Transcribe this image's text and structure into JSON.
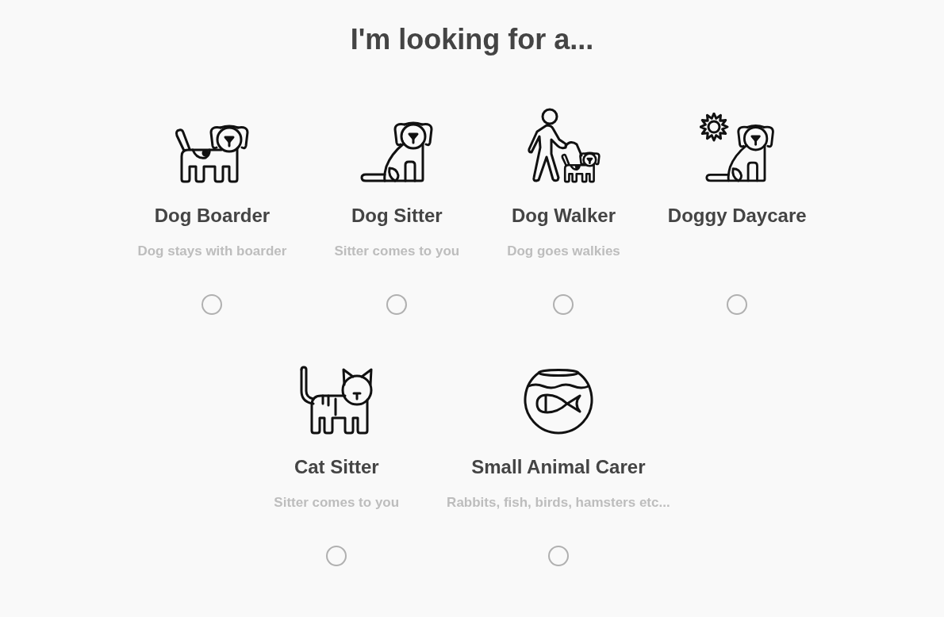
{
  "heading": "I'm looking for a...",
  "rows": [
    {
      "options": [
        {
          "kind": "boarding",
          "title": "Dog Boarder",
          "description": "Dog stays with boarder",
          "selected": false
        },
        {
          "kind": "sitting",
          "title": "Dog Sitter",
          "description": "Sitter comes to you",
          "selected": false
        },
        {
          "kind": "walking",
          "title": "Dog Walker",
          "description": "Dog goes walkies",
          "selected": false
        },
        {
          "kind": "daycare",
          "title": "Doggy Daycare",
          "selected": false
        }
      ]
    },
    {
      "options": [
        {
          "kind": "cat",
          "title": "Cat Sitter",
          "description": "Sitter comes to you",
          "selected": false
        },
        {
          "kind": "smallanimals",
          "title": "Small Animal Carer",
          "description": "Rabbits, fish, birds, hamsters etc...",
          "selected": false
        }
      ]
    }
  ]
}
